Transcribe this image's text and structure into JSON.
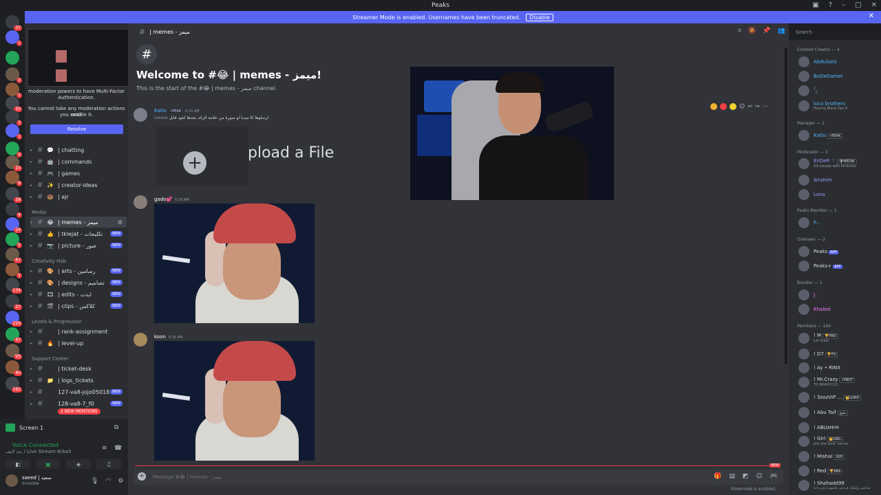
{
  "window": {
    "title": "Peaks"
  },
  "banner": {
    "text": "Streamer Mode is enabled. Usernames have been truncated.",
    "disable_label": "Disable"
  },
  "guilds": [
    {
      "badge": "37"
    },
    {
      "badge": "1"
    },
    {
      "badge": ""
    },
    {
      "badge": "2"
    },
    {
      "badge": "1"
    },
    {
      "badge": "15"
    },
    {
      "badge": "3"
    },
    {
      "badge": "1"
    },
    {
      "badge": "a"
    },
    {
      "badge": "15"
    },
    {
      "badge": "9"
    },
    {
      "badge": "18"
    },
    {
      "badge": "4"
    },
    {
      "badge": "24"
    },
    {
      "badge": "5"
    },
    {
      "badge": "67"
    },
    {
      "badge": "1"
    },
    {
      "badge": "134"
    },
    {
      "badge": "27"
    },
    {
      "badge": "229"
    },
    {
      "badge": "47"
    },
    {
      "badge": "VS"
    },
    {
      "badge": "40"
    },
    {
      "badge": "161"
    }
  ],
  "mfa": {
    "line1": "moderation powers to have Multi-Factor",
    "line2": "Authentication.",
    "line3": "You cannot take any moderation actions until",
    "line4": "you enable it.",
    "button": "Resolve"
  },
  "channels": {
    "top": [
      {
        "emoji": "💬",
        "name": "| chatting"
      },
      {
        "emoji": "🤖",
        "name": "| commands"
      },
      {
        "emoji": "🎮",
        "name": "| games"
      },
      {
        "emoji": "✨",
        "name": "| creator-ideas"
      },
      {
        "emoji": "🍩",
        "name": "| ajr"
      }
    ],
    "media_label": "Media",
    "media": [
      {
        "emoji": "😂",
        "name": "| memes - ميمز",
        "new": ""
      },
      {
        "emoji": "👍",
        "name": "| tklejat - تكليجات",
        "new": "NEW"
      },
      {
        "emoji": "📷",
        "name": "| picture - صور",
        "new": "NEW"
      }
    ],
    "creativity_label": "Creativity Hub",
    "creativity": [
      {
        "emoji": "🎨",
        "name": "| arts - رسامين",
        "new": "NEW"
      },
      {
        "emoji": "🎨",
        "name": "| designs - تصاميم",
        "new": "NEW"
      },
      {
        "emoji": "🎞",
        "name": "| edits - ايدت",
        "new": "NEW"
      },
      {
        "emoji": "🎬",
        "name": "| clips - كلاكس",
        "new": "NEW"
      }
    ],
    "levels_label": "Levels & Progression",
    "levels": [
      {
        "emoji": "",
        "name": "| rank-assignment"
      },
      {
        "emoji": "🔥",
        "name": "| level-up"
      }
    ],
    "support_label": "Support Center",
    "support": [
      {
        "emoji": "",
        "name": "| ticket-desk",
        "new": ""
      },
      {
        "emoji": "📁",
        "name": "| logs_tickets",
        "new": ""
      },
      {
        "emoji": "",
        "name": "127-va8-jojo05018",
        "new": "NEW"
      },
      {
        "emoji": "",
        "name": "128-va8-7_f0",
        "new": "NEW"
      }
    ],
    "mentions": "2 NEW MENTIONS"
  },
  "voice": {
    "screen": "Screen 1",
    "status": "Voice Connected",
    "sub": "بث لايف / Live Stream 6rba5",
    "user": "saeed | سعيد",
    "user_status": "Invisible"
  },
  "header": {
    "channel": "| memes - ميمز",
    "search_placeholder": "Search"
  },
  "welcome": {
    "title": "Welcome to #😂 | memes - ميمز!",
    "subtitle": "This is the start of the #😂 | memes - ميمز channel."
  },
  "messages": [
    {
      "name": "Kaito",
      "tag": "⚡PEAK",
      "time": "6:15 AM",
      "text": "ارسلوها كا ميديا او صورة من علامة الزائد بجدها ابلود فايل",
      "edited": "(edited)"
    },
    {
      "name": "gado💕",
      "time": "6:16 AM"
    },
    {
      "name": "koon",
      "time": "6:16 AM"
    }
  ],
  "upload": {
    "text": "pload a File"
  },
  "composer": {
    "placeholder": "Message #😂 | memes - ميمز"
  },
  "slowmode": "Slowmode is enabled.",
  "new_marker": "NEW",
  "members": {
    "creator": "Content Creator — 4",
    "creator_list": [
      {
        "name": "Abdulaziz",
        "color": "#4fb8ff",
        "sub": ""
      },
      {
        "name": "BoDeGamer",
        "color": "#4fb8ff",
        "sub": ""
      },
      {
        "name": "!_",
        "color": "#4fb8ff",
        "sub": "..!"
      },
      {
        "name": "loco brothers",
        "color": "#4fb8ff",
        "sub": "Playing Black Ops 6"
      }
    ],
    "manager": "Manager — 1",
    "manager_list": [
      {
        "name": "Kaito",
        "color": "#4fb8ff",
        "badge": "⚡PEAK"
      }
    ],
    "moderator": "Moderator — 3",
    "moderator_list": [
      {
        "name": "EnDeR ♡",
        "color": "#949cf7",
        "badge": "🛡MEOW",
        "sub": "Kill people with kindness"
      },
      {
        "name": "ibrahim",
        "color": "#949cf7",
        "sub": ""
      },
      {
        "name": "Lana",
        "color": "#949cf7",
        "sub": ""
      }
    ],
    "peaks_member": "Peaks Member — 1",
    "peaks_list": [
      {
        "name": "P...",
        "color": "#4fb8ff"
      }
    ],
    "overseer": "Overseer — 2",
    "overseer_list": [
      {
        "name": "Peaks",
        "app": "APP"
      },
      {
        "name": "Peaks+",
        "app": "APP"
      }
    ],
    "booster": "Booster — 2",
    "booster_list": [
      {
        "name": "J.",
        "color": "#f47fff"
      },
      {
        "name": "Khaled",
        "color": "#f47fff"
      }
    ],
    "members_label": "Members — 164",
    "member_list": [
      {
        "name": "! M",
        "badge": "🏆PRO",
        "sub": "Let them"
      },
      {
        "name": "! D7",
        "badge": "🏆FX",
        "sub": ""
      },
      {
        "name": "! Ay • RINX",
        "badge": "",
        "sub": ""
      },
      {
        "name": "! Mr.Crazy",
        "badge": "⚡PBOT",
        "sub": "TO MOROCCO"
      },
      {
        "name": "! 3zozVIP ...",
        "badge": "👑LORD",
        "sub": ""
      },
      {
        "name": "! Abu Taif",
        "badge": "شيخ",
        "sub": ""
      },
      {
        "name": "! ABUzHrH",
        "badge": "",
        "sub": ""
      },
      {
        "name": "! Girl",
        "badge": "👑GIRL",
        "sub": "Join the Girls' server"
      },
      {
        "name": "! Mishal",
        "badge": "505",
        "sub": ""
      },
      {
        "name": "! Red",
        "badge": "🏆889",
        "sub": ""
      },
      {
        "name": "! Shahadd99",
        "badge": "",
        "sub": "ساعتين وليلتك فرحتي عاشوره نحن بابنا"
      }
    ]
  },
  "colors": {
    "accent": "#5865f2",
    "danger": "#f23f43",
    "online": "#23a559"
  }
}
